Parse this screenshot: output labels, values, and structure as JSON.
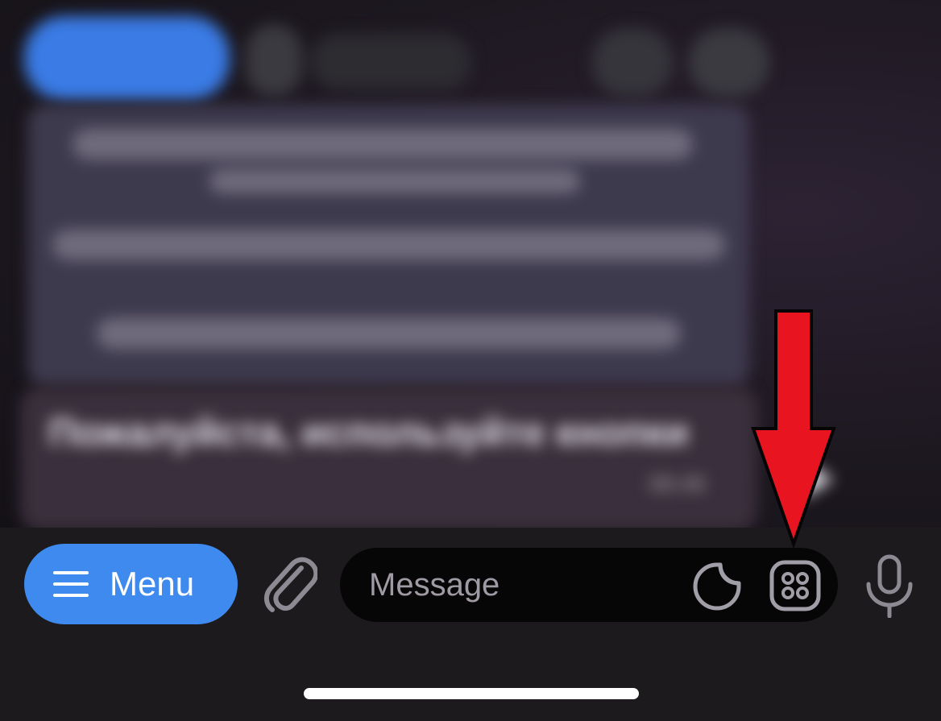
{
  "chat": {
    "message_text": "Пожалуйста, используйте кнопки",
    "message_time": "08:48"
  },
  "input_bar": {
    "menu_label": "Menu",
    "message_placeholder": "Message",
    "message_value": ""
  },
  "icons": {
    "menu": "hamburger-icon",
    "attach": "paperclip-icon",
    "sticker": "sticker-icon",
    "keyboard": "bot-keyboard-icon",
    "mic": "microphone-icon",
    "share": "share-arrow-icon",
    "annotation": "red-down-arrow"
  },
  "colors": {
    "menu_button": "#3e8aef",
    "annotation_arrow": "#e8141f",
    "input_field": "#070607",
    "icon_gray": "#9f9aa3"
  }
}
